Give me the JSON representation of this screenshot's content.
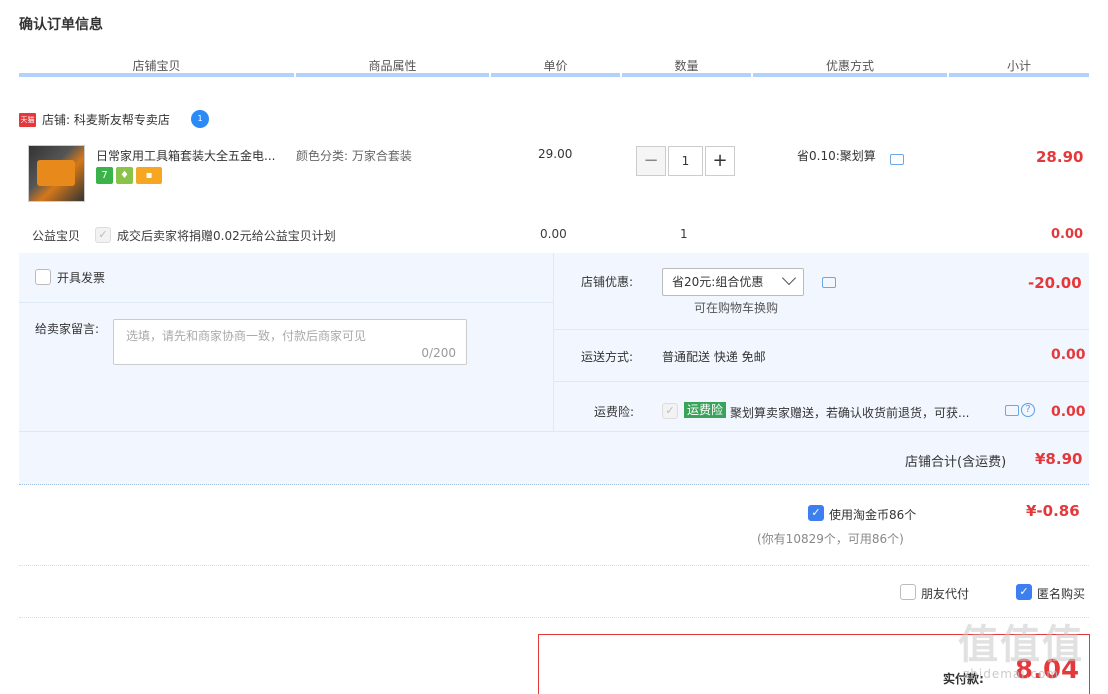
{
  "page_title": "确认订单信息",
  "columns": [
    "店铺宝贝",
    "商品属性",
    "单价",
    "数量",
    "优惠方式",
    "小计"
  ],
  "shop": {
    "tag": "天猫",
    "label": "店铺: 科麦斯友帮专卖店",
    "ww": "1"
  },
  "item": {
    "name": "日常家用工具箱套装大全五金电...",
    "attr": "颜色分类: 万家合套装",
    "price": "29.00",
    "qty": "1",
    "minus": "−",
    "plus": "+",
    "promo": "省0.10:聚划算",
    "subtotal": "28.90",
    "badges": [
      "7",
      "♦",
      "▪"
    ]
  },
  "charity": {
    "label": "公益宝贝",
    "check": "✓",
    "text": "成交后卖家将捐赠0.02元给公益宝贝计划",
    "price": "0.00",
    "qty": "1",
    "subtotal": "0.00"
  },
  "invoice": {
    "label": "开具发票"
  },
  "message": {
    "label": "给卖家留言:",
    "placeholder": "选填，请先和商家协商一致，付款后商家可见",
    "count": "0/200"
  },
  "shop_discount": {
    "label": "店铺优惠:",
    "selected": "省20元:组合优惠",
    "hint": "可在购物车换购",
    "amount": "-20.00"
  },
  "shipping": {
    "label": "运送方式:",
    "value": "普通配送 快递 免邮",
    "amount": "0.00"
  },
  "insurance": {
    "label": "运费险:",
    "check": "✓",
    "tag": "运费险",
    "text": "聚划算卖家赠送，若确认收货前退货，可获...",
    "help": "?",
    "amount": "0.00"
  },
  "shop_total": {
    "label": "店铺合计(含运费)",
    "amount": "¥8.90"
  },
  "coins": {
    "check": "✓",
    "label": "使用淘金币86个",
    "sub": "(你有10829个，可用86个)",
    "amount": "¥-0.86"
  },
  "options": {
    "friend_pay": "朋友代付",
    "anonymous_check": "✓",
    "anonymous": "匿名购买"
  },
  "pay": {
    "label": "实付款:",
    "amount": "8.04"
  },
  "watermark": {
    "big": "值值值",
    "small": "zhidemai.com"
  },
  "colors": {
    "accent_red": "#e4393c",
    "header_line": "#b2d1ff",
    "panel_bg": "#f2f7ff",
    "checkbox_blue": "#3d7fee"
  }
}
